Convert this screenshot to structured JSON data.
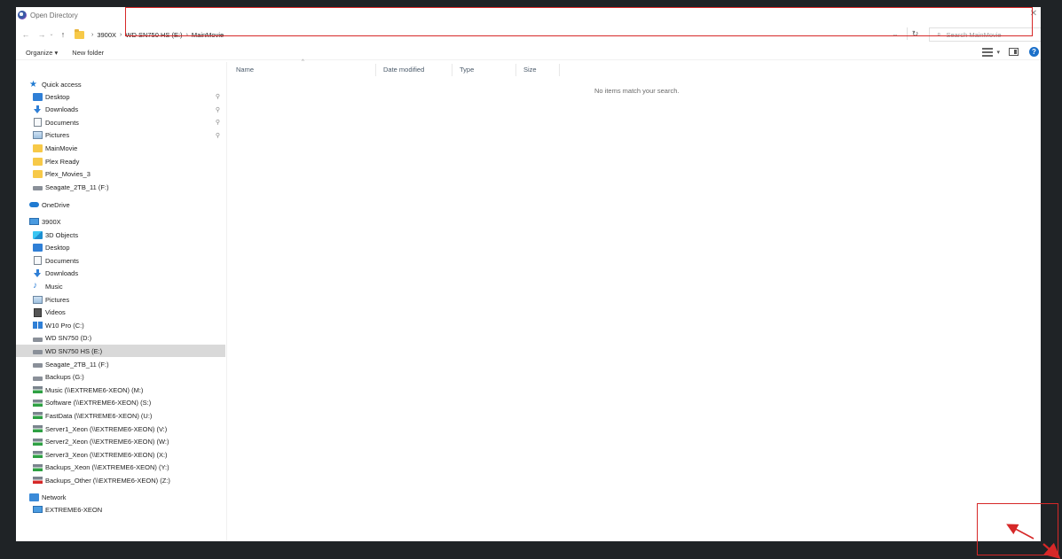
{
  "window": {
    "title": "Open Directory",
    "close_glyph": "✕"
  },
  "address": {
    "crumbs": [
      "3900X",
      "WD SN750 HS (E:)",
      "MainMovie"
    ],
    "search_placeholder": "Search MainMovie"
  },
  "toolbar": {
    "organize_label": "Organize ▾",
    "new_folder_label": "New folder"
  },
  "nav": {
    "quick_access_label": "Quick access",
    "quick_access": [
      {
        "label": "Desktop",
        "icon": "desktop-icon",
        "pinned": true
      },
      {
        "label": "Downloads",
        "icon": "download-icon",
        "pinned": true
      },
      {
        "label": "Documents",
        "icon": "documents-icon",
        "pinned": true
      },
      {
        "label": "Pictures",
        "icon": "pictures-icon",
        "pinned": true
      },
      {
        "label": "MainMovie",
        "icon": "folder-icon",
        "pinned": false
      },
      {
        "label": "Plex Ready",
        "icon": "folder-icon",
        "pinned": false
      },
      {
        "label": "Plex_Movies_3",
        "icon": "folder-icon",
        "pinned": false
      },
      {
        "label": "Seagate_2TB_11 (F:)",
        "icon": "drive-icon",
        "pinned": false
      }
    ],
    "onedrive_label": "OneDrive",
    "pc_label": "3900X",
    "pc_items": [
      {
        "label": "3D Objects",
        "icon": "3d-objects-icon"
      },
      {
        "label": "Desktop",
        "icon": "desktop-icon"
      },
      {
        "label": "Documents",
        "icon": "documents-icon"
      },
      {
        "label": "Downloads",
        "icon": "download-icon"
      },
      {
        "label": "Music",
        "icon": "music-icon"
      },
      {
        "label": "Pictures",
        "icon": "pictures-icon"
      },
      {
        "label": "Videos",
        "icon": "videos-icon"
      },
      {
        "label": "W10 Pro (C:)",
        "icon": "windows-drive-icon"
      },
      {
        "label": "WD SN750 (D:)",
        "icon": "drive-icon"
      },
      {
        "label": "WD SN750 HS (E:)",
        "icon": "drive-icon",
        "selected": true
      },
      {
        "label": "Seagate_2TB_11 (F:)",
        "icon": "drive-icon"
      },
      {
        "label": "Backups (G:)",
        "icon": "drive-icon"
      },
      {
        "label": "Music (\\\\EXTREME6-XEON) (M:)",
        "icon": "network-drive-icon"
      },
      {
        "label": "Software (\\\\EXTREME6-XEON) (S:)",
        "icon": "network-drive-icon"
      },
      {
        "label": "FastData (\\\\EXTREME6-XEON) (U:)",
        "icon": "network-drive-icon"
      },
      {
        "label": "Server1_Xeon (\\\\EXTREME6-XEON) (V:)",
        "icon": "network-drive-icon"
      },
      {
        "label": "Server2_Xeon (\\\\EXTREME6-XEON) (W:)",
        "icon": "network-drive-icon"
      },
      {
        "label": "Server3_Xeon (\\\\EXTREME6-XEON) (X:)",
        "icon": "network-drive-icon"
      },
      {
        "label": "Backups_Xeon (\\\\EXTREME6-XEON) (Y:)",
        "icon": "network-drive-icon"
      },
      {
        "label": "Backups_Other (\\\\EXTREME6-XEON) (Z:)",
        "icon": "network-drive-disconnected-icon"
      }
    ],
    "network_label": "Network",
    "network_items": [
      {
        "label": "EXTREME6-XEON",
        "icon": "network-computer-icon"
      }
    ]
  },
  "content": {
    "columns": [
      "Name",
      "Date modified",
      "Type",
      "Size"
    ],
    "empty_message": "No items match your search."
  },
  "colors": {
    "highlight": "#d62828",
    "selection": "#d9d9d9",
    "accent": "#1f7ad1"
  }
}
